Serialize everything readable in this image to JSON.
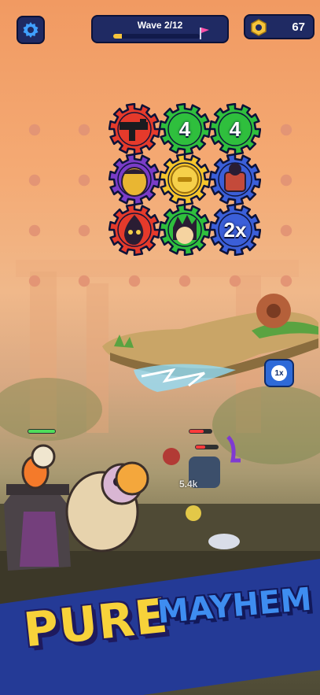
{
  "hud": {
    "wave_label": "Wave 2/12",
    "wave_progress": 0.1,
    "coins": "67",
    "settings_icon": "gear-icon",
    "coin_icon": "hex-nut-icon"
  },
  "board": {
    "gears": [
      {
        "row": 0,
        "col": 0,
        "color": "#e53a2b",
        "item": "smg-weapon",
        "label": ""
      },
      {
        "row": 0,
        "col": 1,
        "color": "#2fbf3d",
        "item": "number",
        "label": "4"
      },
      {
        "row": 0,
        "col": 2,
        "color": "#2fbf3d",
        "item": "number",
        "label": "4"
      },
      {
        "row": 1,
        "col": 0,
        "color": "#7a3cc7",
        "item": "blob-hero",
        "label": ""
      },
      {
        "row": 1,
        "col": 1,
        "color": "#f4c42c",
        "item": "coin-slot",
        "label": ""
      },
      {
        "row": 1,
        "col": 2,
        "color": "#3b5fd9",
        "item": "robot-hero",
        "label": ""
      },
      {
        "row": 2,
        "col": 0,
        "color": "#e53a2b",
        "item": "flame-hero",
        "label": ""
      },
      {
        "row": 2,
        "col": 1,
        "color": "#2fbf3d",
        "item": "spiky-hero",
        "label": ""
      },
      {
        "row": 2,
        "col": 2,
        "color": "#3b5fd9",
        "item": "multiplier",
        "label": "2x"
      }
    ]
  },
  "speed_button": "1x",
  "damage_popup": "5.4k",
  "banner": {
    "word1": "PURE",
    "word2": "MAYHEM"
  }
}
